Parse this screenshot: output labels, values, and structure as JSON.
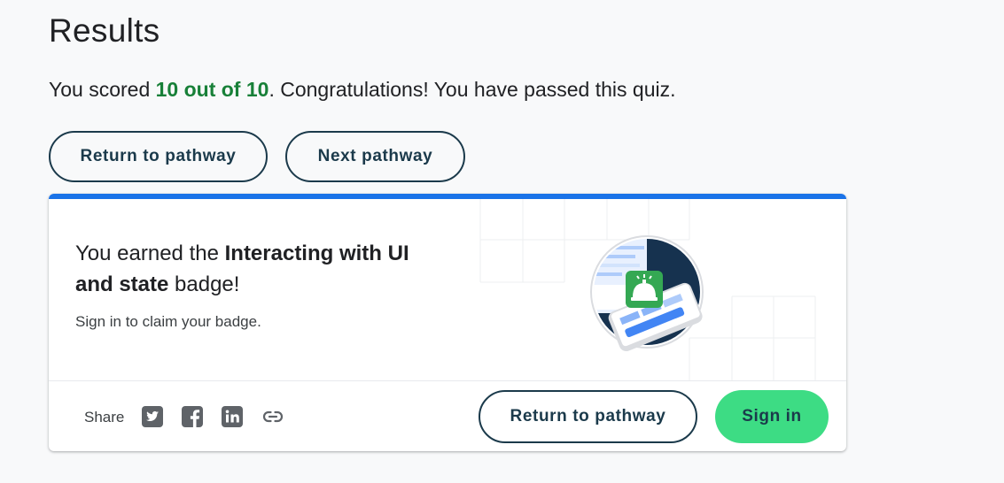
{
  "results": {
    "title": "Results",
    "score_prefix": "You scored ",
    "score_value": "10 out of 10",
    "score_suffix": ". Congratulations! You have passed this quiz."
  },
  "actions": {
    "return_label": "Return to pathway",
    "next_label": "Next pathway"
  },
  "badge_card": {
    "heading_prefix": "You earned the ",
    "badge_name": "Interacting with UI and state",
    "heading_suffix": " badge!",
    "claim_text": "Sign in to claim your badge.",
    "image_icon": "service-bell-badge-icon",
    "accent_color": "#1a73e8"
  },
  "footer": {
    "share_label": "Share",
    "share_icons": [
      "twitter-icon",
      "facebook-icon",
      "linkedin-icon",
      "link-icon"
    ],
    "return_label": "Return to pathway",
    "signin_label": "Sign in",
    "signin_color": "#3ddc84"
  },
  "colors": {
    "score_green": "#188038",
    "button_border": "#1b3a4b",
    "background": "#f8f9fa"
  }
}
